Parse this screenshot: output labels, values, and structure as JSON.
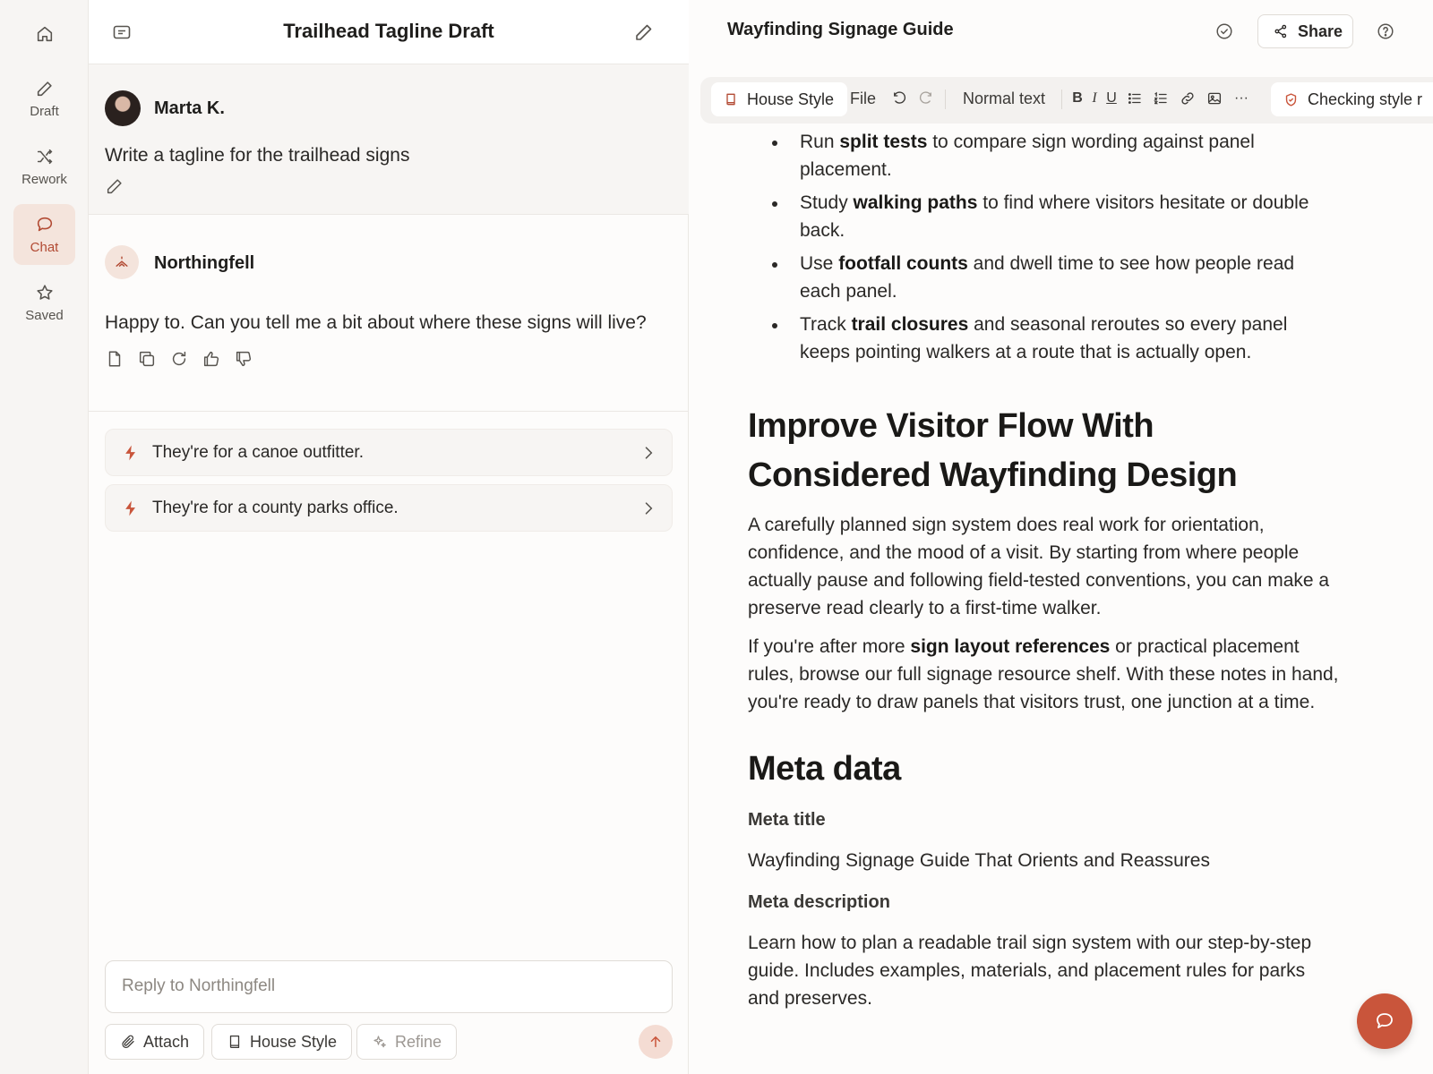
{
  "nav": {
    "items": [
      {
        "label": "",
        "icon": "home-icon"
      },
      {
        "label": "Draft",
        "icon": "pencil-icon"
      },
      {
        "label": "Rework",
        "icon": "shuffle-icon"
      },
      {
        "label": "Chat",
        "icon": "chat-bubble-icon",
        "active": true
      },
      {
        "label": "Saved",
        "icon": "star-icon"
      }
    ]
  },
  "chat": {
    "title": "Trailhead Tagline Draft",
    "user": {
      "name": "Marta K.",
      "message": "Write a tagline for the trailhead signs"
    },
    "assistant": {
      "name": "Northingfell",
      "message": "Happy to. Can you tell me a bit about where these signs will live?"
    },
    "suggestions": [
      {
        "text": "They're for a canoe outfitter."
      },
      {
        "text": "They're for a county parks office."
      }
    ],
    "reply_placeholder": "Reply to Northingfell",
    "attach_label": "Attach",
    "house_style_label": "House Style",
    "refine_label": "Refine"
  },
  "editor": {
    "doc_title": "Wayfinding Signage Guide",
    "share_label": "Share",
    "toolbar": {
      "house_style": "House Style",
      "file": "File",
      "normal_text": "Normal text",
      "checking": "Checking style r"
    },
    "bullets": [
      {
        "pre": "Run ",
        "bold": "split tests",
        "post": " to compare sign wording against panel placement."
      },
      {
        "pre": "Study ",
        "bold": "walking paths",
        "post": " to find where visitors hesitate or double back."
      },
      {
        "pre": "Use ",
        "bold": "footfall counts",
        "post": " and dwell time to see how people read each panel."
      },
      {
        "pre": "Track ",
        "bold": "trail closures",
        "post": " and seasonal reroutes so every panel keeps pointing walkers at a route that is actually open."
      }
    ],
    "heading_1": "Improve Visitor Flow With Considered Wayfinding Design",
    "para_1": "A carefully planned sign system does real work for orientation, confidence, and the mood of a visit. By starting from where people actually pause and following field-tested conventions, you can make a preserve read clearly to a first-time walker.",
    "para_2": {
      "pre": "If you're after more ",
      "bold": "sign layout references",
      "post": " or practical placement rules, browse our full signage resource shelf. With these notes in hand, you're ready to draw panels that visitors trust, one junction at a time."
    },
    "heading_2": "Meta data",
    "meta_title_label": "Meta title",
    "meta_title_value": "Wayfinding Signage Guide That Orients and Reassures",
    "meta_desc_label": "Meta description",
    "meta_desc_value": "Learn how to plan a readable trail sign system with our step-by-step guide. Includes examples, materials, and placement rules for parks and preserves."
  },
  "colors": {
    "accent": "#c9553b",
    "accent_soft": "#f4e4dc",
    "panel_bg": "#f7f5f3"
  }
}
